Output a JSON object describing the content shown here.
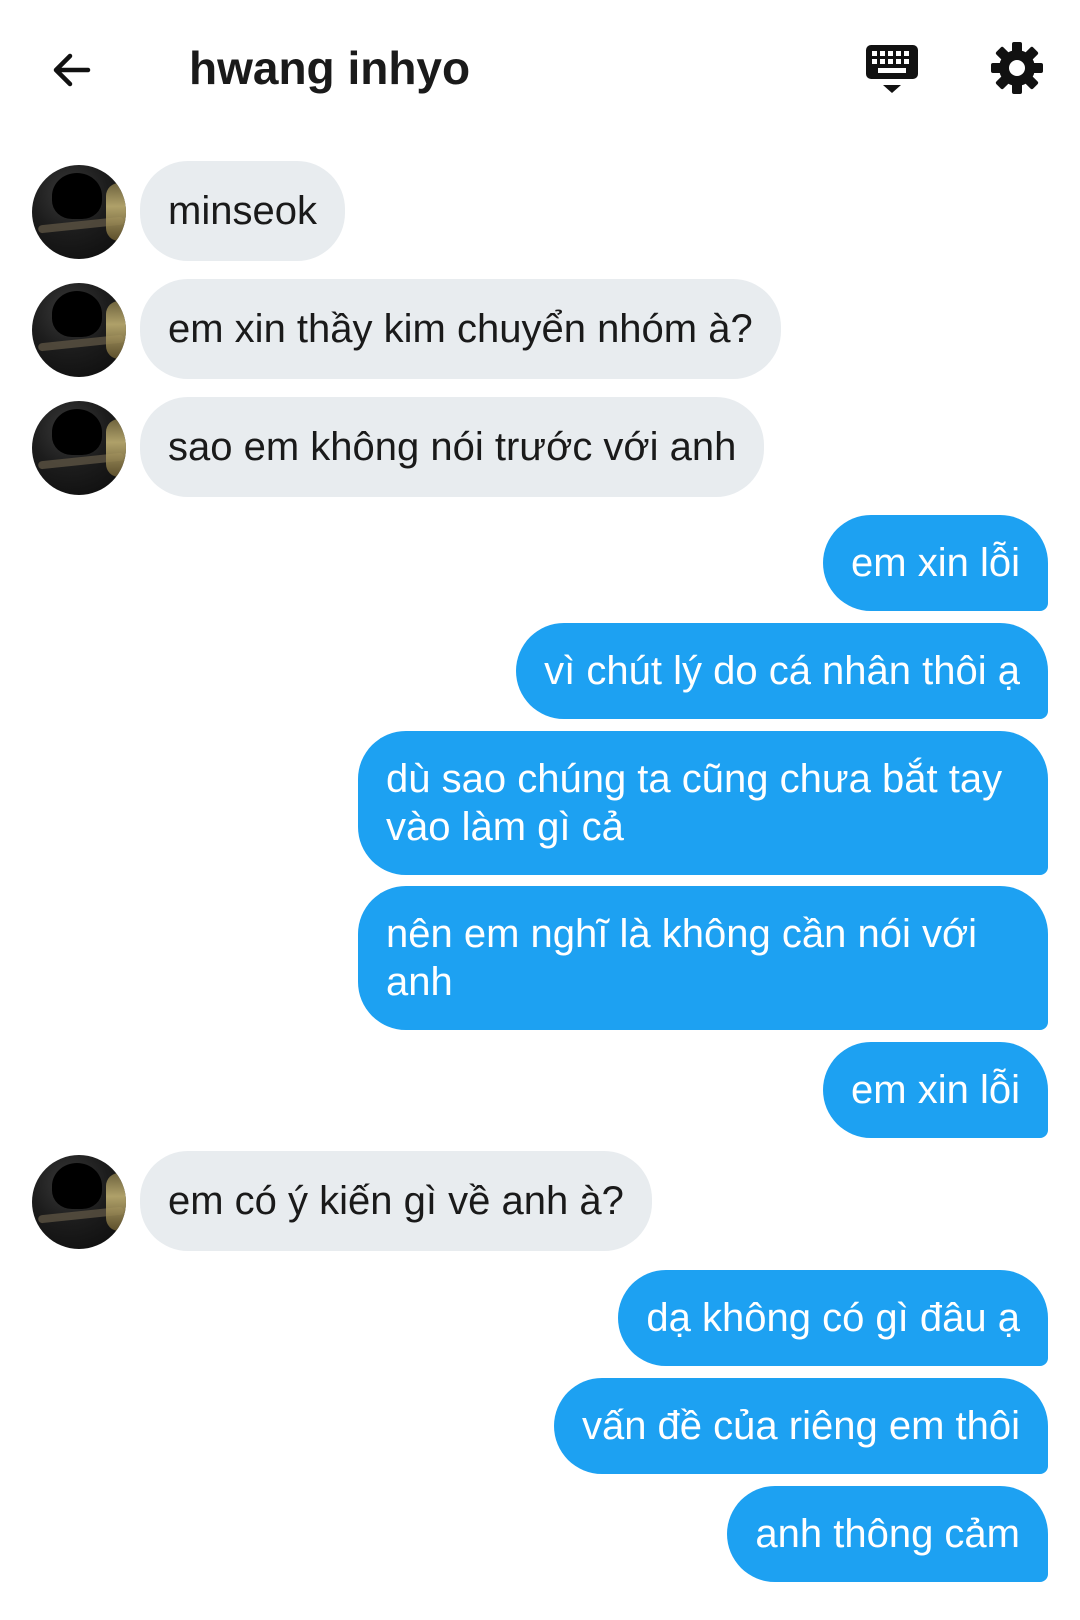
{
  "header": {
    "title": "hwang inhyo",
    "icons": {
      "back": "arrow-left-icon",
      "keyboard": "keyboard-icon",
      "settings": "gear-icon"
    }
  },
  "colors": {
    "outgoing_bubble": "#1da1f2",
    "incoming_bubble": "#e8ecef",
    "outgoing_text": "#ffffff",
    "incoming_text": "#1a1a1a"
  },
  "messages": [
    {
      "side": "in",
      "text": "minseok"
    },
    {
      "side": "in",
      "text": "em xin thầy kim chuyển nhóm à?"
    },
    {
      "side": "in",
      "text": "sao em không nói trước với anh"
    },
    {
      "side": "out",
      "text": "em xin lỗi"
    },
    {
      "side": "out",
      "text": "vì chút lý do cá nhân thôi ạ"
    },
    {
      "side": "out",
      "text": "dù sao chúng ta cũng chưa bắt tay vào làm gì cả"
    },
    {
      "side": "out",
      "text": "nên em nghĩ là không cần nói với anh"
    },
    {
      "side": "out",
      "text": "em xin lỗi"
    },
    {
      "side": "in",
      "text": "em có ý kiến gì về anh à?"
    },
    {
      "side": "out",
      "text": "dạ không có gì đâu ạ"
    },
    {
      "side": "out",
      "text": "vấn đề của riêng em thôi"
    },
    {
      "side": "out",
      "text": "anh thông cảm"
    }
  ]
}
